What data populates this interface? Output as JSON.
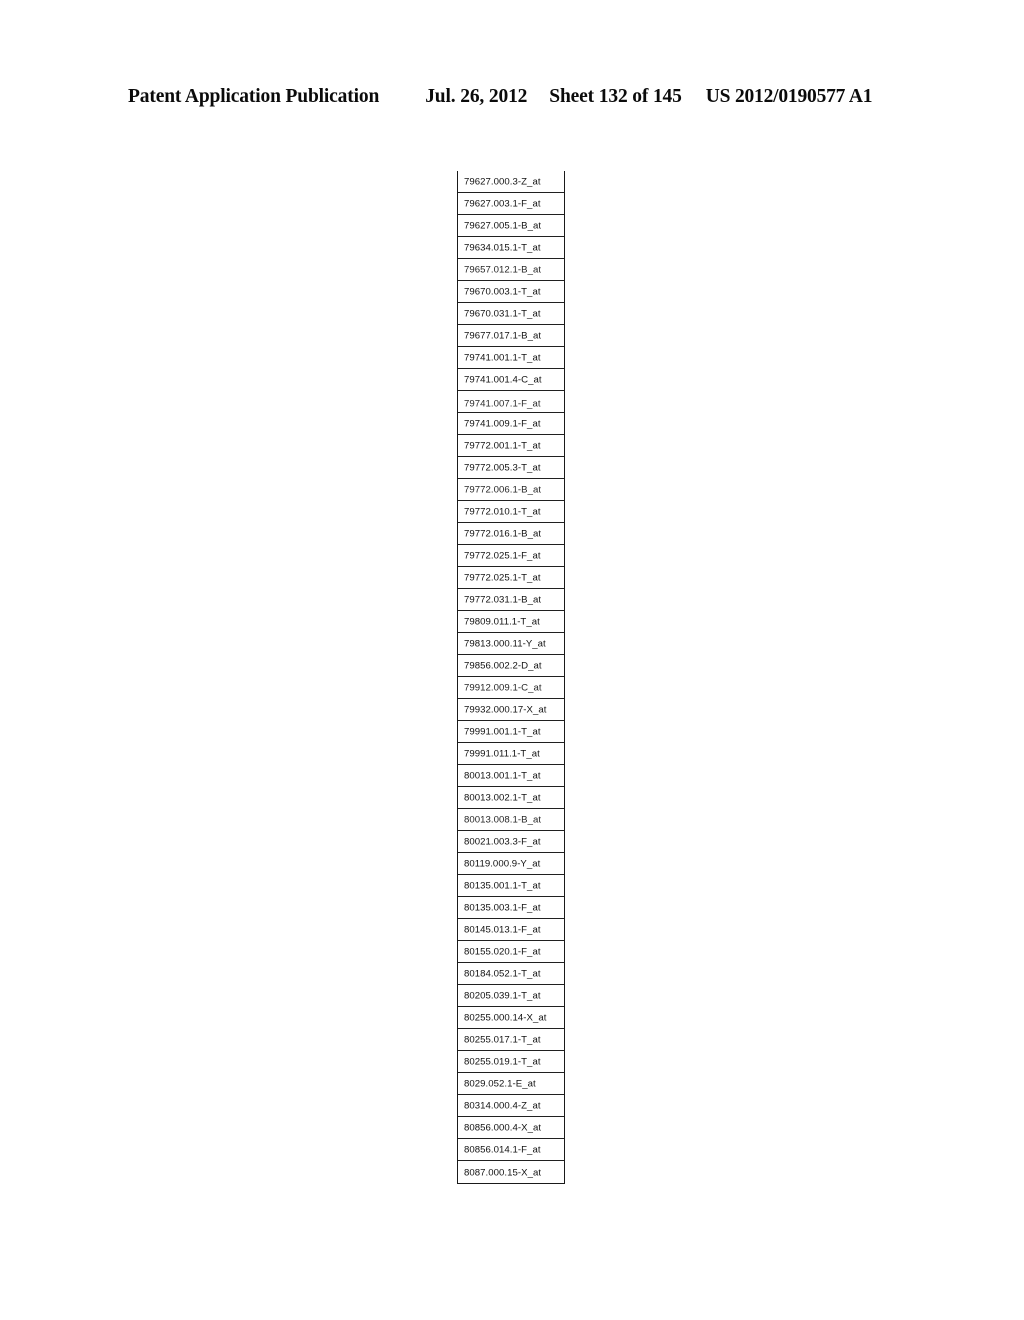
{
  "header": {
    "title": "Patent Application Publication",
    "date": "Jul. 26, 2012",
    "sheet": "Sheet 132 of 145",
    "publication_number": "US 2012/0190577 A1"
  },
  "table": {
    "rows": [
      {
        "id": "79627.000.3-Z_at"
      },
      {
        "id": "79627.003.1-F_at"
      },
      {
        "id": "79627.005.1-B_at"
      },
      {
        "id": "79634.015.1-T_at"
      },
      {
        "id": "79657.012.1-B_at"
      },
      {
        "id": "79670.003.1-T_at"
      },
      {
        "id": "79670.031.1-T_at"
      },
      {
        "id": "79677.017.1-B_at"
      },
      {
        "id": "79741.001.1-T_at"
      },
      {
        "id": "79741.001.4-C_at"
      },
      {
        "id": "79741.007.1-F_at"
      },
      {
        "id": "79741.009.1-F_at"
      },
      {
        "id": "79772.001.1-T_at"
      },
      {
        "id": "79772.005.3-T_at"
      },
      {
        "id": "79772.006.1-B_at"
      },
      {
        "id": "79772.010.1-T_at"
      },
      {
        "id": "79772.016.1-B_at"
      },
      {
        "id": "79772.025.1-F_at"
      },
      {
        "id": "79772.025.1-T_at"
      },
      {
        "id": "79772.031.1-B_at"
      },
      {
        "id": "79809.011.1-T_at"
      },
      {
        "id": "79813.000.11-Y_at"
      },
      {
        "id": "79856.002.2-D_at"
      },
      {
        "id": "79912.009.1-C_at"
      },
      {
        "id": "79932.000.17-X_at"
      },
      {
        "id": "79991.001.1-T_at"
      },
      {
        "id": "79991.011.1-T_at"
      },
      {
        "id": "80013.001.1-T_at"
      },
      {
        "id": "80013.002.1-T_at"
      },
      {
        "id": "80013.008.1-B_at"
      },
      {
        "id": "80021.003.3-F_at"
      },
      {
        "id": "80119.000.9-Y_at"
      },
      {
        "id": "80135.001.1-T_at"
      },
      {
        "id": "80135.003.1-F_at"
      },
      {
        "id": "80145.013.1-F_at"
      },
      {
        "id": "80155.020.1-F_at"
      },
      {
        "id": "80184.052.1-T_at"
      },
      {
        "id": "80205.039.1-T_at"
      },
      {
        "id": "80255.000.14-X_at"
      },
      {
        "id": "80255.017.1-T_at"
      },
      {
        "id": "80255.019.1-T_at"
      },
      {
        "id": "8029.052.1-E_at"
      },
      {
        "id": "80314.000.4-Z_at"
      },
      {
        "id": "80856.000.4-X_at"
      },
      {
        "id": "80856.014.1-F_at"
      },
      {
        "id": "8087.000.15-X_at"
      }
    ]
  }
}
